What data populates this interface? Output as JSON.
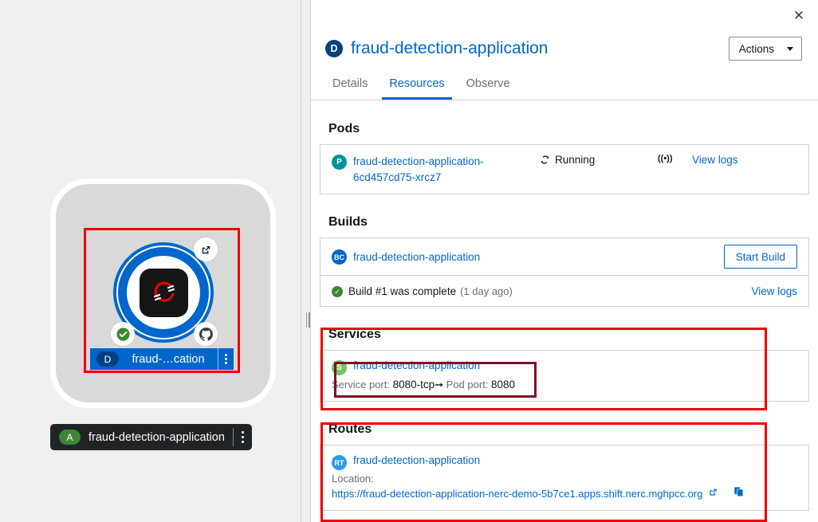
{
  "topology": {
    "node": {
      "kind_initial": "D",
      "label": "fraud-…cation",
      "badges": {
        "external_link": "external-link-icon",
        "status": "check-circle-icon",
        "source": "github-icon"
      },
      "logo": "openshift-logo-icon"
    },
    "application": {
      "kind_initial": "A",
      "label": "fraud-detection-application"
    }
  },
  "panel": {
    "close_label": "✕",
    "resource_initial": "D",
    "title": "fraud-detection-application",
    "actions_label": "Actions",
    "tabs": [
      {
        "label": "Details",
        "active": false
      },
      {
        "label": "Resources",
        "active": true
      },
      {
        "label": "Observe",
        "active": false
      }
    ],
    "pods": {
      "heading": "Pods",
      "items": [
        {
          "kind": "P",
          "name": "fraud-detection-application-6cd457cd75-xrcz7",
          "status": "Running",
          "signal": "((•))",
          "logs_label": "View logs"
        }
      ]
    },
    "builds": {
      "heading": "Builds",
      "config_kind": "BC",
      "config_name": "fraud-detection-application",
      "start_build_label": "Start Build",
      "status_text": "Build #1 was complete",
      "status_time": "(1 day ago)",
      "logs_label": "View logs"
    },
    "services": {
      "heading": "Services",
      "items": [
        {
          "kind": "S",
          "name": "fraud-detection-application",
          "port_prefix": "Service port: ",
          "service_port": "8080-tcp",
          "arrow": "➞",
          "pod_port_prefix": " Pod port: ",
          "pod_port": "8080"
        }
      ]
    },
    "routes": {
      "heading": "Routes",
      "items": [
        {
          "kind": "RT",
          "name": "fraud-detection-application",
          "location_label": "Location:",
          "url": "https://fraud-detection-application-nerc-demo-5b7ce1.apps.shift.nerc.mghpcc.org",
          "external_icon": "external-link-icon",
          "copy_icon": "copy-icon"
        }
      ]
    }
  }
}
